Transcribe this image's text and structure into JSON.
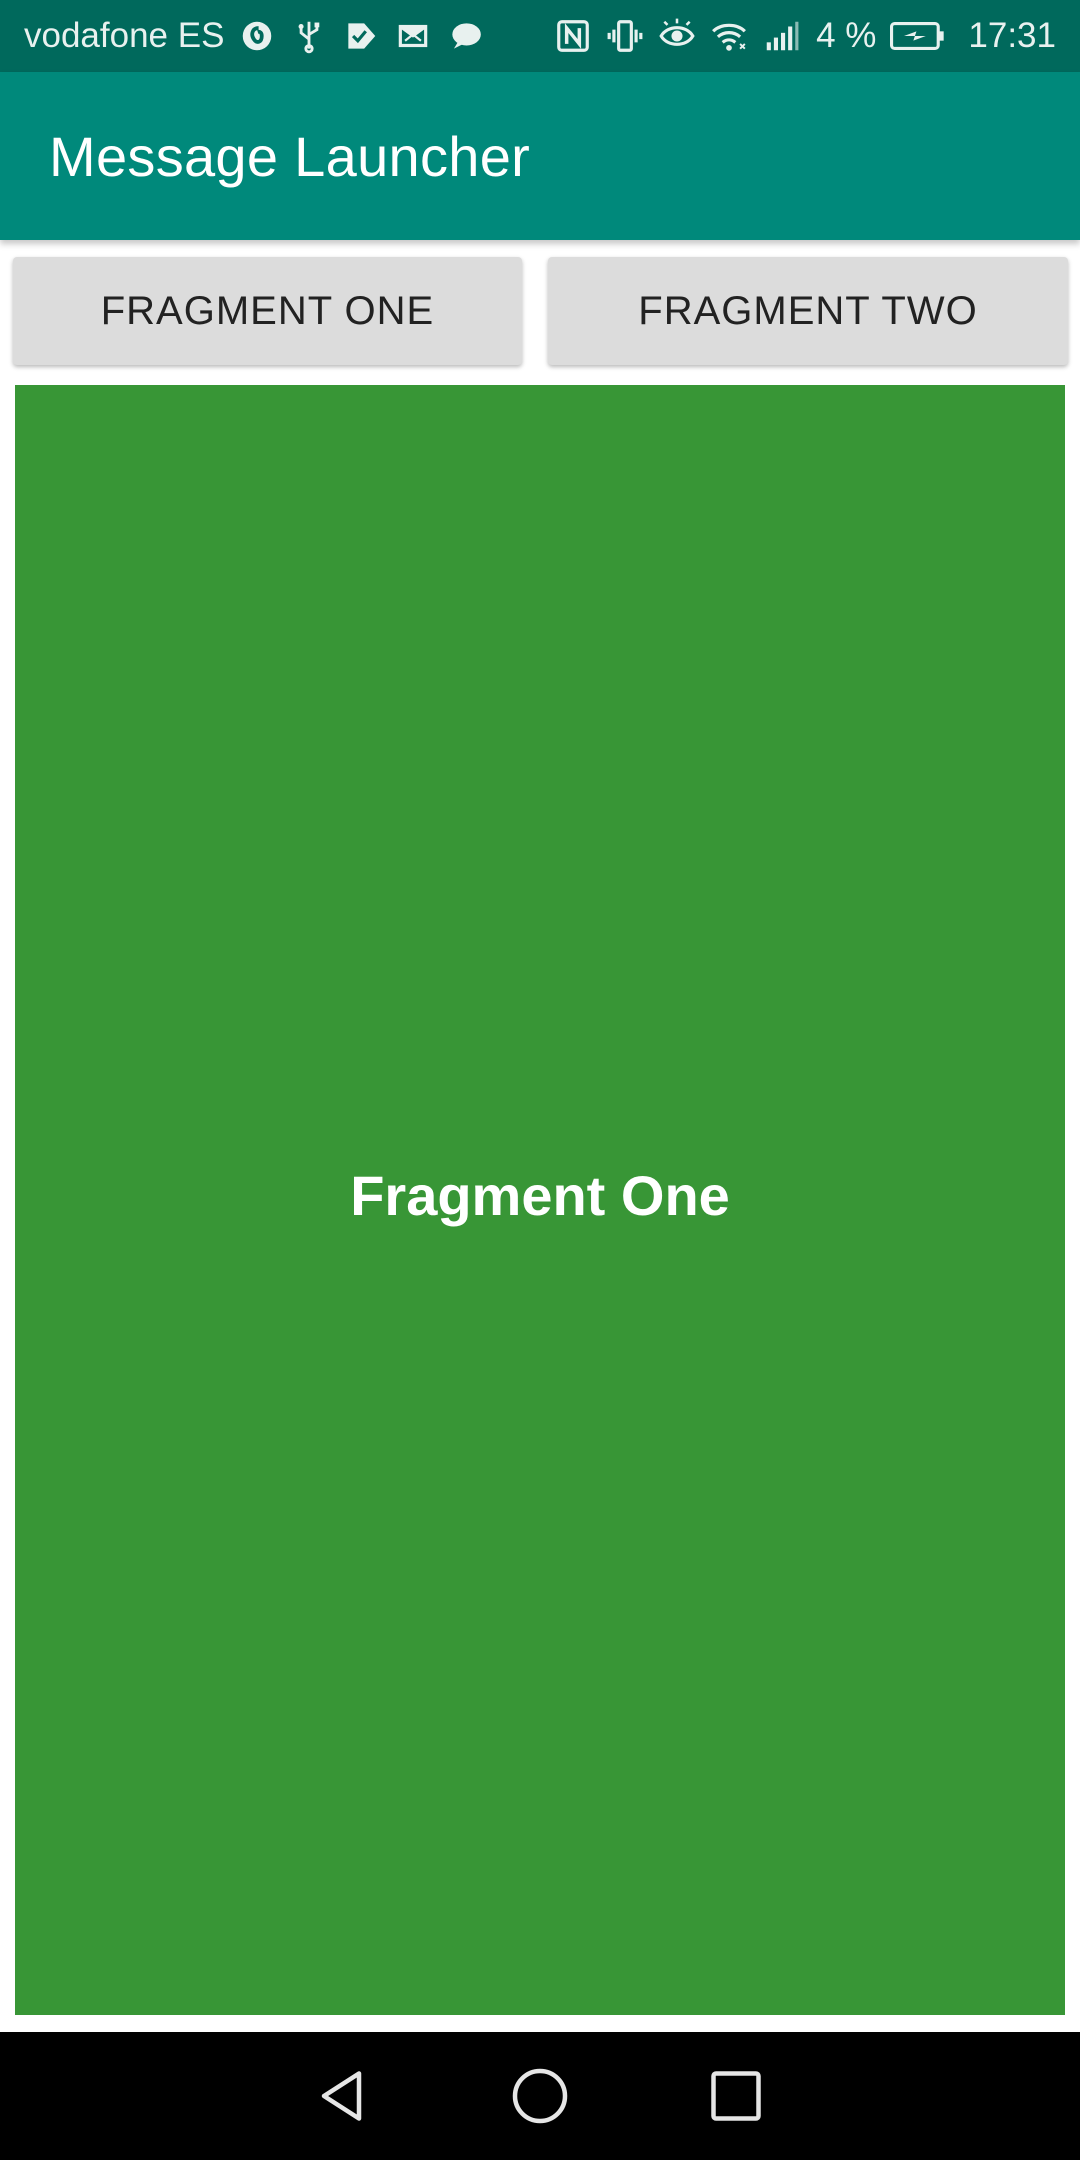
{
  "status_bar": {
    "carrier": "vodafone ES",
    "battery_percent": "4 %",
    "time": "17:31",
    "left_icons": [
      "vodafone-logo-icon",
      "usb-icon",
      "download-check-icon",
      "gmail-icon",
      "chat-bubble-icon"
    ],
    "right_icons": [
      "nfc-icon",
      "vibrate-icon",
      "eye-icon",
      "wifi-icon",
      "signal-icon",
      "battery-charging-icon"
    ]
  },
  "app_bar": {
    "title": "Message Launcher"
  },
  "buttons": {
    "fragment_one": "FRAGMENT ONE",
    "fragment_two": "FRAGMENT TWO"
  },
  "fragment": {
    "text": "Fragment One",
    "background": "#389636"
  },
  "nav_bar": {
    "icons": [
      "back-icon",
      "home-icon",
      "recents-icon"
    ]
  },
  "colors": {
    "status_bar": "#00695c",
    "app_bar": "#00897b",
    "button_bg": "#dcdcdc",
    "fragment_green": "#389636"
  }
}
